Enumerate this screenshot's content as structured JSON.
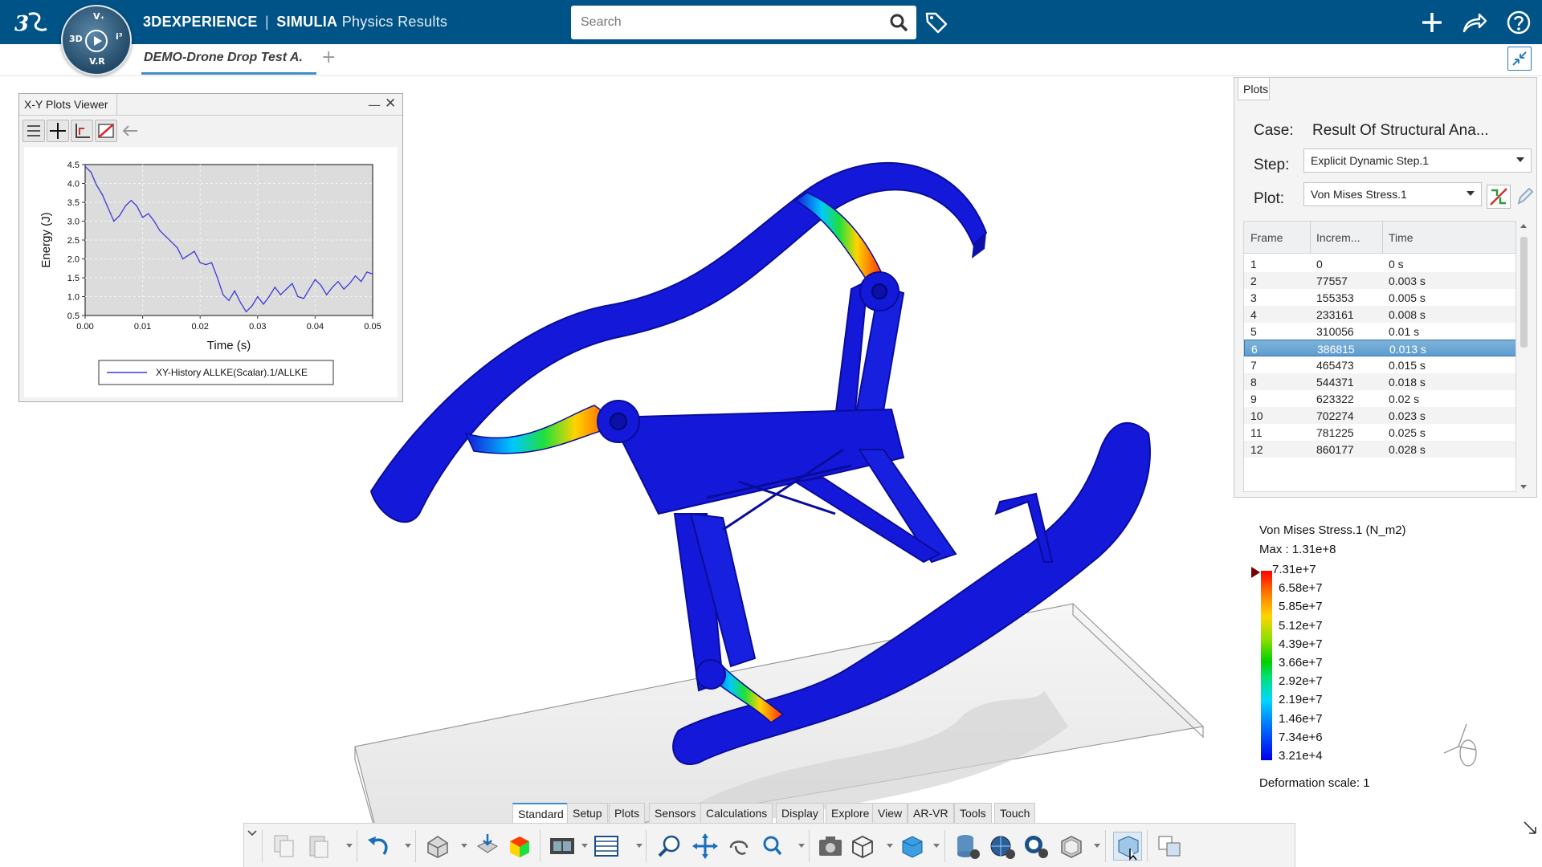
{
  "topbar": {
    "brand_primary": "3DEXPERIENCE",
    "brand_separator": "|",
    "brand_app": "SIMULIA",
    "brand_app_sub": "Physics Results",
    "compass_labels": {
      "top": "V₊",
      "left": "3D",
      "right": "i³",
      "bottom": "V.R"
    },
    "search_placeholder": "Search",
    "icons": [
      "search-icon",
      "tag-icon",
      "plus-icon",
      "share-icon",
      "help-icon"
    ]
  },
  "tabs": {
    "document_tab": "DEMO-Drone Drop Test A.",
    "add_tab": "+"
  },
  "xy_viewer": {
    "title": "X-Y Plots Viewer",
    "minimize": "—",
    "close": "✕",
    "tools": [
      "list-icon",
      "fit-all-icon",
      "axis-icon",
      "clear-plot-icon",
      "back-arrow-icon"
    ],
    "legend_entry": "XY-History ALLKE(Scalar).1/ALLKE"
  },
  "chart_data": {
    "type": "line",
    "xlabel": "Time (s)",
    "ylabel": "Energy (J)",
    "xlim": [
      0.0,
      0.05
    ],
    "ylim": [
      0.5,
      4.5
    ],
    "x_ticks": [
      "0.00",
      "0.01",
      "0.02",
      "0.03",
      "0.04",
      "0.05"
    ],
    "y_ticks": [
      "0.5",
      "1.0",
      "1.5",
      "2.0",
      "2.5",
      "3.0",
      "3.5",
      "4.0",
      "4.5"
    ],
    "grid": true,
    "legend_placement": "bottom",
    "series": [
      {
        "name": "XY-History ALLKE(Scalar).1/ALLKE",
        "color": "#3a3ad8",
        "x": [
          0.0,
          0.001,
          0.002,
          0.003,
          0.004,
          0.005,
          0.006,
          0.007,
          0.008,
          0.009,
          0.01,
          0.011,
          0.012,
          0.013,
          0.014,
          0.015,
          0.016,
          0.017,
          0.018,
          0.019,
          0.02,
          0.021,
          0.022,
          0.023,
          0.024,
          0.025,
          0.026,
          0.027,
          0.028,
          0.029,
          0.03,
          0.031,
          0.032,
          0.033,
          0.034,
          0.035,
          0.036,
          0.037,
          0.038,
          0.039,
          0.04,
          0.041,
          0.042,
          0.043,
          0.044,
          0.045,
          0.046,
          0.047,
          0.048,
          0.049,
          0.05
        ],
        "y": [
          4.45,
          4.3,
          3.95,
          3.7,
          3.35,
          3.0,
          3.15,
          3.4,
          3.55,
          3.4,
          3.1,
          3.2,
          3.0,
          2.75,
          2.6,
          2.45,
          2.3,
          2.0,
          2.1,
          2.2,
          1.9,
          1.85,
          1.9,
          1.5,
          1.05,
          0.9,
          1.15,
          0.85,
          0.6,
          0.75,
          1.0,
          0.8,
          1.0,
          1.25,
          1.05,
          1.2,
          1.35,
          1.0,
          0.95,
          1.2,
          1.45,
          1.3,
          1.05,
          1.25,
          1.4,
          1.2,
          1.35,
          1.55,
          1.4,
          1.65,
          1.6
        ]
      }
    ]
  },
  "plots_panel": {
    "tab_label": "Plots",
    "case_label": "Case:",
    "case_value": "Result Of Structural Ana...",
    "step_label": "Step:",
    "step_value": "Explicit Dynamic Step.1",
    "plot_label": "Plot:",
    "plot_value": "Von Mises Stress.1",
    "columns": [
      "Frame",
      "Increm...",
      "Time"
    ],
    "rows": [
      {
        "frame": "1",
        "increment": "0",
        "time": "0 s"
      },
      {
        "frame": "2",
        "increment": "77557",
        "time": "0.003 s"
      },
      {
        "frame": "3",
        "increment": "155353",
        "time": "0.005 s"
      },
      {
        "frame": "4",
        "increment": "233161",
        "time": "0.008 s"
      },
      {
        "frame": "5",
        "increment": "310056",
        "time": "0.01 s"
      },
      {
        "frame": "6",
        "increment": "386815",
        "time": "0.013 s"
      },
      {
        "frame": "7",
        "increment": "465473",
        "time": "0.015 s"
      },
      {
        "frame": "8",
        "increment": "544371",
        "time": "0.018 s"
      },
      {
        "frame": "9",
        "increment": "623322",
        "time": "0.02 s"
      },
      {
        "frame": "10",
        "increment": "702274",
        "time": "0.023 s"
      },
      {
        "frame": "11",
        "increment": "781225",
        "time": "0.025 s"
      },
      {
        "frame": "12",
        "increment": "860177",
        "time": "0.028 s"
      }
    ],
    "selected_frame": "6"
  },
  "legend": {
    "title": "Von Mises Stress.1 (N_m2)",
    "max": "Max : 1.31e+8",
    "values": [
      "7.31e+7",
      "6.58e+7",
      "5.85e+7",
      "5.12e+7",
      "4.39e+7",
      "3.66e+7",
      "2.92e+7",
      "2.19e+7",
      "1.46e+7",
      "7.34e+6",
      "3.21e+4"
    ],
    "deformation": "Deformation scale: 1",
    "gradient_colors": [
      "#ff0000",
      "#ffd400",
      "#00d000",
      "#00d8ff",
      "#0000e8"
    ]
  },
  "toolbar": {
    "tabs": [
      "Standard",
      "Setup",
      "Plots",
      "Sensors",
      "Calculations",
      "Display",
      "Explore",
      "View",
      "AR-VR",
      "Tools",
      "Touch"
    ],
    "active_tab": "Standard",
    "icons": [
      "collapse-chevron-icon",
      "copy-icon",
      "paste-icon",
      "undo-icon",
      "part-icon",
      "import-icon",
      "result-display-icon",
      "animation-icon",
      "table-icon",
      "zoom-icon",
      "pan-icon",
      "rotate-icon",
      "search-icon",
      "capture-icon",
      "view-cube-icon",
      "shading-icon",
      "database-icon",
      "mesh-icon",
      "query-icon",
      "box-icon",
      "section-view-icon",
      "compare-icon"
    ]
  },
  "colors": {
    "topbar": "#005386",
    "accent": "#3d8dc8",
    "model_blue": "#1418d8",
    "selected_row": "#5d9dcf"
  }
}
